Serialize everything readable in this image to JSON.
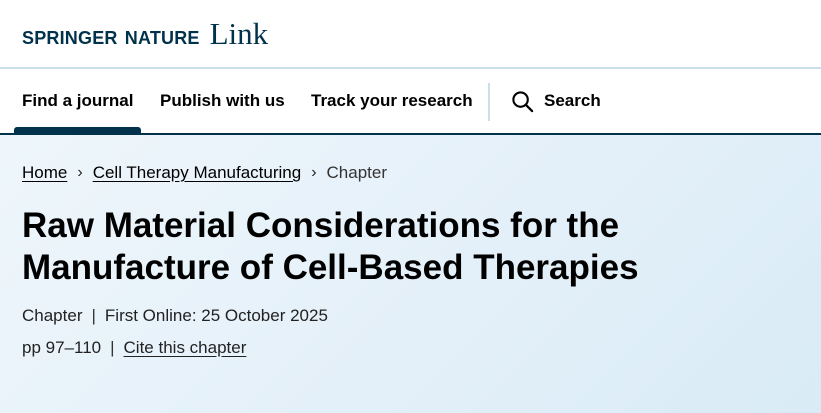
{
  "header": {
    "brand": "SPRINGER NATURE",
    "brand_suffix": "Link"
  },
  "nav": {
    "items": [
      {
        "label": "Find a journal",
        "active": true
      },
      {
        "label": "Publish with us",
        "active": false
      },
      {
        "label": "Track your research",
        "active": false
      }
    ],
    "search_label": "Search",
    "search_icon": "search-icon"
  },
  "breadcrumb": {
    "home": "Home",
    "book": "Cell Therapy Manufacturing",
    "current": "Chapter"
  },
  "article": {
    "title_line1": "Raw Material Considerations for the",
    "title_line2": "Manufacture of Cell-Based Therapies",
    "type": "Chapter",
    "first_online": "First Online: 25 October 2025",
    "pages": "pp 97–110",
    "cite_label": "Cite this chapter"
  },
  "colors": {
    "brand": "#01324b",
    "hero_background": "#e4f0f9",
    "divider": "#c9dfea"
  }
}
